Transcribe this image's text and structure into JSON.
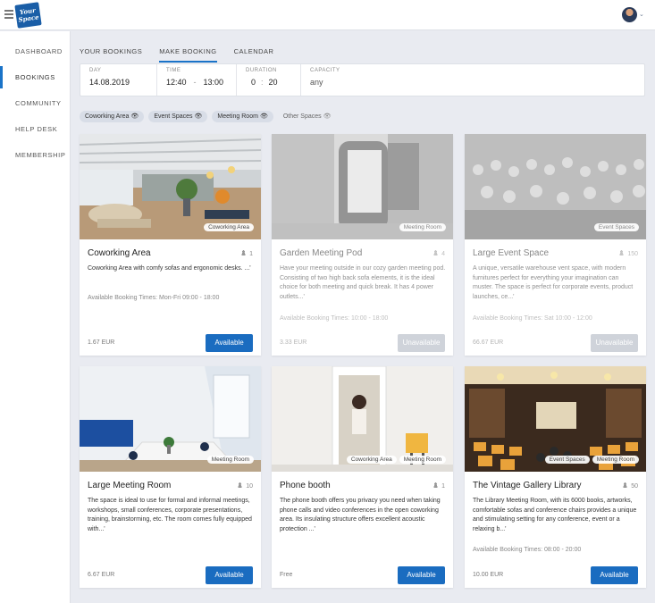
{
  "app": {
    "logo_text": "Your Space"
  },
  "sidebar": {
    "items": [
      {
        "label": "DASHBOARD"
      },
      {
        "label": "BOOKINGS"
      },
      {
        "label": "COMMUNITY"
      },
      {
        "label": "HELP DESK"
      },
      {
        "label": "MEMBERSHIP"
      }
    ]
  },
  "tabs": [
    {
      "label": "YOUR BOOKINGS"
    },
    {
      "label": "MAKE BOOKING"
    },
    {
      "label": "CALENDAR"
    }
  ],
  "filters": {
    "day": {
      "label": "DAY",
      "value": "14.08.2019"
    },
    "time": {
      "label": "TIME",
      "from": "12:40",
      "sep": "-",
      "to": "13:00"
    },
    "duration": {
      "label": "DURATION",
      "hours": "0",
      "sep": ":",
      "minutes": "20"
    },
    "capacity": {
      "label": "CAPACITY",
      "value": "any"
    }
  },
  "chips": [
    {
      "label": "Coworking Area",
      "active": true
    },
    {
      "label": "Event Spaces",
      "active": true
    },
    {
      "label": "Meeting Room",
      "active": true
    },
    {
      "label": "Other Spaces",
      "active": false
    }
  ],
  "cards": [
    {
      "title": "Coworking Area",
      "capacity": "1",
      "tags": [
        "Coworking Area"
      ],
      "description": "Coworking Area with comfy sofas and ergonomic desks. ...'",
      "times": "Available Booking Times: Mon-Fri 09:00 - 18:00",
      "price": "1.67 EUR",
      "button": "Available",
      "available": true
    },
    {
      "title": "Garden Meeting Pod",
      "capacity": "4",
      "tags": [
        "Meeting Room"
      ],
      "description": "Have your meeting outside in our cozy garden meeting pod. Consisting of two high back sofa elements, it is the ideal choice for both meeting and quick break. It has 4 power outlets...'",
      "times": "Available Booking Times: 10:00 - 18:00",
      "price": "3.33 EUR",
      "button": "Unavailable",
      "available": false
    },
    {
      "title": "Large Event Space",
      "capacity": "150",
      "tags": [
        "Event Spaces"
      ],
      "description": "A unique, versatile warehouse vent space, with modern furnitures perfect for everything your imagination can muster. The space is perfect for corporate events, product launches, ce...'",
      "times": "Available Booking Times: Sat 10:00 - 12:00",
      "price": "66.67 EUR",
      "button": "Unavailable",
      "available": false
    },
    {
      "title": "Large Meeting Room",
      "capacity": "10",
      "tags": [
        "Meeting Room"
      ],
      "description": "The space is ideal to use for formal and informal meetings, workshops, small conferences, corporate presentations, training, brainstorming, etc. The room comes fully equipped with...'",
      "times": "",
      "price": "6.67 EUR",
      "button": "Available",
      "available": true
    },
    {
      "title": "Phone booth",
      "capacity": "1",
      "tags": [
        "Coworking Area",
        "Meeting Room"
      ],
      "description": "The phone booth offers you privacy you need when taking phone calls and video conferences in the open coworking area. Its insulating structure offers excellent acoustic protection ...'",
      "times": "",
      "price": "Free",
      "button": "Available",
      "available": true
    },
    {
      "title": "The Vintage Gallery Library",
      "capacity": "50",
      "tags": [
        "Event Spaces",
        "Meeting Room"
      ],
      "description": "The Library Meeting Room, with its 6000 books, artworks, comfortable sofas and conference chairs provides a unique and stimulating setting for any conference, event or a relaxing b...'",
      "times": "Available Booking Times: 08:00 - 20:00",
      "price": "10.00 EUR",
      "button": "Available",
      "available": true
    }
  ],
  "colors": {
    "accent": "#1a6cc0",
    "brand": "#1a5ea7",
    "background": "#e9ebf1"
  }
}
